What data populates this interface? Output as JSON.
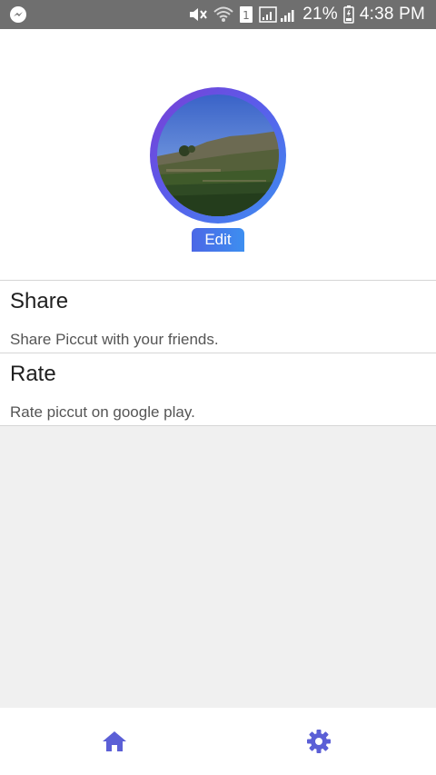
{
  "status_bar": {
    "battery": "21%",
    "time": "4:38 PM",
    "sim_slot": "1",
    "icons": [
      "messenger-icon",
      "mute-icon",
      "wifi-icon",
      "sim-icon",
      "signal-icon",
      "battery-icon"
    ]
  },
  "profile": {
    "edit_label": "Edit"
  },
  "list": {
    "items": [
      {
        "title": "Share",
        "description": "Share Piccut with your friends."
      },
      {
        "title": "Rate",
        "description": "Rate piccut on google play."
      }
    ]
  },
  "bottom_nav": {
    "items": [
      "home-icon",
      "settings-icon"
    ],
    "accent": "#5b5fd6"
  },
  "colors": {
    "status_bar": "#6f6f6f",
    "background": "#f0f0f0",
    "avatar_gradient_start": "#7a3fd4",
    "avatar_gradient_end": "#3d8ff0"
  }
}
